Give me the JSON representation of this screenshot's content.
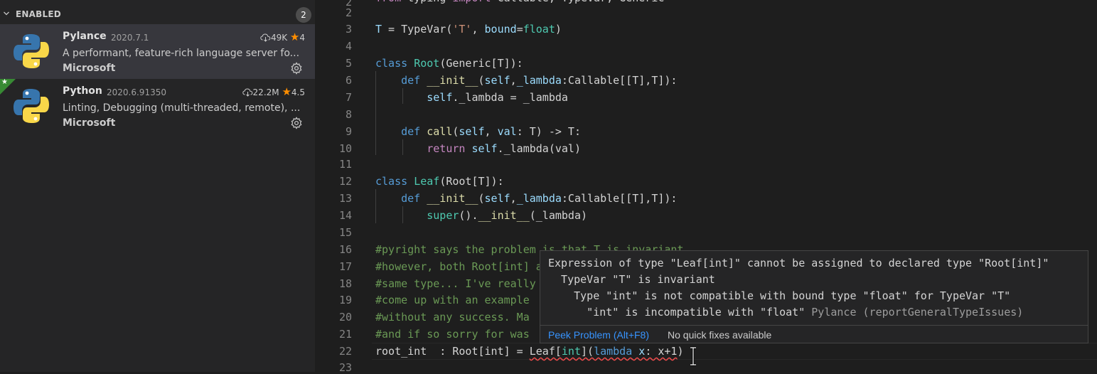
{
  "sidebar": {
    "section_title": "ENABLED",
    "section_count": "2",
    "extensions": [
      {
        "name": "Pylance",
        "version": "2020.7.1",
        "downloads": "49K",
        "rating": "4",
        "description": "A performant, feature-rich language server fo...",
        "publisher": "Microsoft",
        "icon": "python-logo-icon",
        "selected": true
      },
      {
        "name": "Python",
        "version": "2020.6.91350",
        "downloads": "22.2M",
        "rating": "4.5",
        "description": "Linting, Debugging (multi-threaded, remote), ...",
        "publisher": "Microsoft",
        "icon": "python-logo-icon",
        "recommended_badge": "★"
      }
    ]
  },
  "editor": {
    "lines": [
      {
        "n": "2",
        "code": "from typing import Callable, TypeVar, Generic"
      },
      {
        "n": "3",
        "code": "T = TypeVar('T', bound=float)"
      },
      {
        "n": "4",
        "code": ""
      },
      {
        "n": "5",
        "code": "class Root(Generic[T]):"
      },
      {
        "n": "6",
        "code": "    def __init__(self,_lambda:Callable[[T],T]):"
      },
      {
        "n": "7",
        "code": "        self._lambda = _lambda"
      },
      {
        "n": "8",
        "code": ""
      },
      {
        "n": "9",
        "code": "    def call(self, val: T) -> T:"
      },
      {
        "n": "10",
        "code": "        return self._lambda(val)"
      },
      {
        "n": "11",
        "code": ""
      },
      {
        "n": "12",
        "code": "class Leaf(Root[T]):"
      },
      {
        "n": "13",
        "code": "    def __init__(self,_lambda:Callable[[T],T]):"
      },
      {
        "n": "14",
        "code": "        super().__init__(_lambda)"
      },
      {
        "n": "15",
        "code": ""
      },
      {
        "n": "16",
        "code": "#pyright says the problem is that T is invariant"
      },
      {
        "n": "17",
        "code": "#however, both Root[int] and Leaf[int] should be the"
      },
      {
        "n": "18",
        "code": "#same type... I've really tried to"
      },
      {
        "n": "19",
        "code": "#come up with an example"
      },
      {
        "n": "20",
        "code": "#without any success. Ma"
      },
      {
        "n": "21",
        "code": "#and if so sorry for was"
      },
      {
        "n": "22",
        "code": "root_int  : Root[int] = Leaf[int](lambda x: x+1)"
      },
      {
        "n": "23",
        "code": ""
      }
    ],
    "hover": {
      "lines": [
        "Expression of type \"Leaf[int]\" cannot be assigned to declared type \"Root[int]\"",
        "  TypeVar \"T\" is invariant",
        "    Type \"int\" is not compatible with bound type \"float\" for TypeVar \"T\"",
        "      \"int\" is incompatible with \"float\""
      ],
      "source": "Pylance (reportGeneralTypeIssues)",
      "peek_label": "Peek Problem (Alt+F8)",
      "no_fix_label": "No quick fixes available"
    }
  },
  "colors": {
    "keyword": "#569cd6",
    "class": "#4ec9b0",
    "string": "#ce9178",
    "function": "#dcdcaa",
    "variable": "#9cdcfe",
    "comment": "#6a9955",
    "link": "#3794ff",
    "star": "#ff8e00",
    "recommended_ribbon": "#388a34"
  }
}
